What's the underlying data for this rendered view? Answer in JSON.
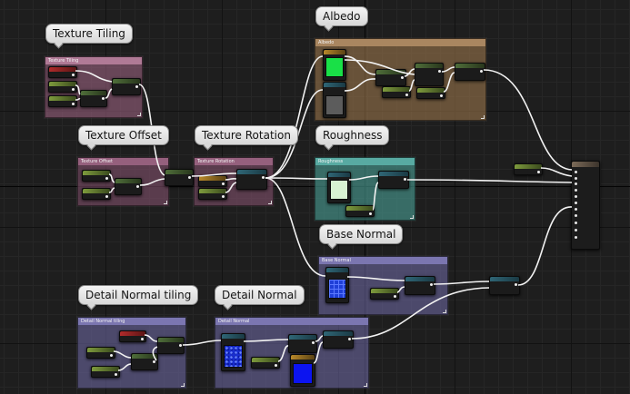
{
  "groups": [
    {
      "id": "texture_tiling",
      "bubble": "Texture Tiling",
      "header": "Texture Tiling",
      "color": "#a46a87"
    },
    {
      "id": "texture_offset",
      "bubble": "Texture Offset",
      "header": "Texture Offset",
      "color": "#8a5a72"
    },
    {
      "id": "texture_rotation",
      "bubble": "Texture Rotation",
      "header": "Texture Rotation",
      "color": "#8a5a72"
    },
    {
      "id": "albedo",
      "bubble": "Albedo",
      "header": "Albedo",
      "color": "#9a7a55"
    },
    {
      "id": "roughness",
      "bubble": "Roughness",
      "header": "Roughness",
      "color": "#4f9d96"
    },
    {
      "id": "base_normal",
      "bubble": "Base Normal",
      "header": "Base Normal",
      "color": "#6c67a0"
    },
    {
      "id": "detail_normal_tiling",
      "bubble": "Detail Normal tiling",
      "header": "Detail Normal tiling",
      "color": "#6c67a0"
    },
    {
      "id": "detail_normal",
      "bubble": "Detail Normal",
      "header": "Detail Normal",
      "color": "#6c67a0"
    }
  ],
  "icons": {
    "node_pin": "circle-dot",
    "resize": "resize-corner"
  }
}
